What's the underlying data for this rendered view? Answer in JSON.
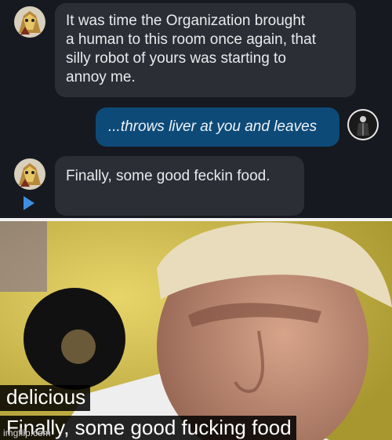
{
  "chat": {
    "messages": [
      {
        "role": "bot",
        "lines": [
          "It was time the Organization brought",
          "a human to this room once again, that",
          "silly robot of yours was starting to",
          "annoy me."
        ]
      },
      {
        "role": "user",
        "lines": [
          "...throws liver at you and leaves"
        ]
      },
      {
        "role": "bot",
        "lines": [
          "Finally, some good feckin food."
        ]
      }
    ],
    "accent_color": "#0d4a78",
    "play_icon_color": "#3d8fe0"
  },
  "meme": {
    "caption_top": "delicious",
    "caption_bottom": "Finally, some good fucking food",
    "watermark": "imgflip.com"
  }
}
